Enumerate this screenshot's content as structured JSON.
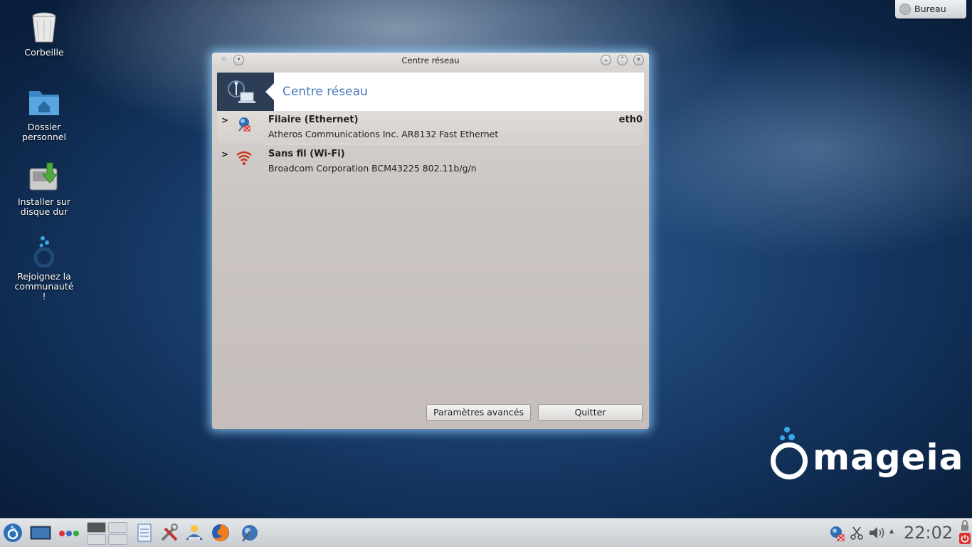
{
  "desktop": {
    "icons": [
      {
        "label": "Corbeille",
        "icon": "trash-icon"
      },
      {
        "label": "Dossier personnel",
        "icon": "home-folder-icon"
      },
      {
        "label": "Installer sur disque dur",
        "icon": "install-disk-icon"
      },
      {
        "label": "Rejoignez la communauté !",
        "icon": "community-icon"
      }
    ],
    "widget": {
      "label": "Bureau",
      "icon": "desktop-icon"
    },
    "logo_text": "mageia"
  },
  "window": {
    "title": "Centre réseau",
    "header_title": "Centre réseau",
    "connections": [
      {
        "name": "Filaire (Ethernet)",
        "description": "Atheros Communications Inc. AR8132 Fast Ethernet",
        "interface": "eth0",
        "icon": "ethernet-disconnected-icon"
      },
      {
        "name": "Sans fil (Wi-Fi)",
        "description": "Broadcom Corporation BCM43225 802.11b/g/n",
        "interface": "",
        "icon": "wifi-icon"
      }
    ],
    "buttons": {
      "advanced": "Paramètres avancés",
      "quit": "Quitter"
    }
  },
  "taskbar": {
    "clock": "22:02",
    "items": [
      "application-launcher-icon",
      "show-desktop-icon",
      "activities-icon",
      "pager",
      "notes-icon",
      "settings-tools-icon",
      "mageia-control-center-icon",
      "firefox-icon",
      "network-center-icon"
    ],
    "tray": [
      "network-status-icon",
      "clipboard-icon",
      "volume-icon",
      "expand-tray-icon",
      "lock-icon",
      "power-icon"
    ]
  },
  "colors": {
    "accent": "#4a7bb8",
    "banner": "#2c3d55",
    "glow": "#96d2ff"
  }
}
